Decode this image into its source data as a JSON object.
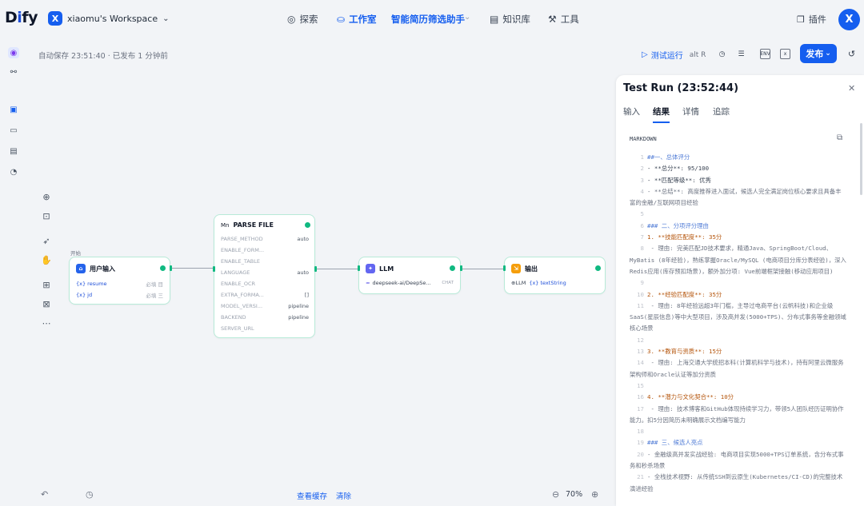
{
  "brand": {
    "logo_text_a": "D",
    "logo_text_b": "i",
    "logo_text_c": "fy"
  },
  "workspace": {
    "badge": "X",
    "name": "xiaomu's Workspace",
    "chevron": "⌄"
  },
  "nav": {
    "explore": "探索",
    "studio": "工作室",
    "app_name": "智能简历筛选助手",
    "knowledge": "知识库",
    "tools": "工具",
    "plugins": "插件"
  },
  "user": {
    "avatar": "X"
  },
  "autosave": "自动保存 23:51:40 · 已发布 1 分钟前",
  "header_actions": {
    "test_run": "测试运行",
    "test_run_shortcut": "alt  R",
    "env_label": "ENV",
    "publish": "发布"
  },
  "nodes": {
    "start_tag": "开始",
    "start": {
      "title": "用户输入",
      "vars": [
        {
          "name": "{x} resume",
          "type": "必填 目"
        },
        {
          "name": "{x} jd",
          "type": "必填 三"
        }
      ]
    },
    "parse": {
      "badge": "Mn",
      "title": "PARSE FILE",
      "params": [
        {
          "k": "PARSE_METHOD",
          "v": "auto"
        },
        {
          "k": "ENABLE_FORM...",
          "v": ""
        },
        {
          "k": "ENABLE_TABLE",
          "v": ""
        },
        {
          "k": "LANGUAGE",
          "v": "auto"
        },
        {
          "k": "ENABLE_OCR",
          "v": ""
        },
        {
          "k": "EXTRA_FORMA...",
          "v": "[]"
        },
        {
          "k": "MODEL_VERSI...",
          "v": "pipeline"
        },
        {
          "k": "BACKEND",
          "v": "pipeline"
        },
        {
          "k": "SERVER_URL",
          "v": ""
        }
      ]
    },
    "llm": {
      "title": "LLM",
      "model": "deepseek-ai/DeepSe...",
      "mode": "CHAT"
    },
    "output": {
      "title": "输出",
      "var_source": "⊕LLM",
      "var_name": "{x} textString"
    }
  },
  "canvas_footer": {
    "view_cache": "查看缓存",
    "clear": "清除",
    "zoom": "70%"
  },
  "panel": {
    "title": "Test Run (23:52:44)",
    "tabs": [
      "输入",
      "结果",
      "详情",
      "追踪"
    ],
    "active_tab": "结果",
    "format_label": "MARKDOWN",
    "lines": [
      {
        "n": "1",
        "t": "##一、总体评分",
        "c": "h"
      },
      {
        "n": "2",
        "t": "- **总分**: 95/100",
        "c": "b"
      },
      {
        "n": "3",
        "t": "- **匹配等级**: 优秀",
        "c": "b"
      },
      {
        "n": "4",
        "t": "- **总结**: 高度推荐进入面试，候选人完全满足岗位核心要求且具备丰富的金融/互联网项目经验",
        "c": ""
      },
      {
        "n": "5",
        "t": "",
        "c": ""
      },
      {
        "n": "6",
        "t": "### 二、分项评分理由",
        "c": "h"
      },
      {
        "n": "7",
        "t": "1. **技能匹配度**: 35分",
        "c": "num"
      },
      {
        "n": "8",
        "t": "   - 理由: 完美匹配JD技术要求，精通Java、SpringBoot/Cloud、MyBatis (8年经验)，熟练掌握Oracle/MySQL (电商项目分库分表经验)，深入Redis应用(库存预扣场景)，额外加分项: Vue前端框架接触(移动应用项目)",
        "c": ""
      },
      {
        "n": "9",
        "t": "",
        "c": ""
      },
      {
        "n": "10",
        "t": "2. **经验匹配度**: 35分",
        "c": "num"
      },
      {
        "n": "11",
        "t": "   - 理由: 8年经验远超3年门槛，主导过电商平台(云帆科技)和企业级SaaS(星辰信息)等中大型项目，涉及高并发(5000+TPS)、分布式事务等金融领域核心场景",
        "c": ""
      },
      {
        "n": "12",
        "t": "",
        "c": ""
      },
      {
        "n": "13",
        "t": "3. **教育与资质**: 15分",
        "c": "num"
      },
      {
        "n": "14",
        "t": "   - 理由: 上海交通大学统招本科(计算机科学与技术)，持有阿里云微服务架构师和Oracle认证等加分资质",
        "c": ""
      },
      {
        "n": "15",
        "t": "",
        "c": ""
      },
      {
        "n": "16",
        "t": "4. **潜力与文化契合**: 10分",
        "c": "num"
      },
      {
        "n": "17",
        "t": "   - 理由: 技术博客和GitHub体现持续学习力，带领5人团队经历证明协作能力。扣5分因简历未明确展示文档编写能力",
        "c": ""
      },
      {
        "n": "18",
        "t": "",
        "c": ""
      },
      {
        "n": "19",
        "t": "### 三、候选人亮点",
        "c": "h"
      },
      {
        "n": "20",
        "t": "- 金融级高并发实战经验: 电商项目实现5000+TPS订单系统，含分布式事务和秒杀场景",
        "c": ""
      },
      {
        "n": "21",
        "t": "- 全栈技术视野: 从传统SSH到云原生(Kubernetes/CI-CD)的完整技术演进经验",
        "c": ""
      }
    ]
  },
  "colors": {
    "accent": "#155eef",
    "success": "#10b981",
    "node_border": "#b8ead8"
  }
}
